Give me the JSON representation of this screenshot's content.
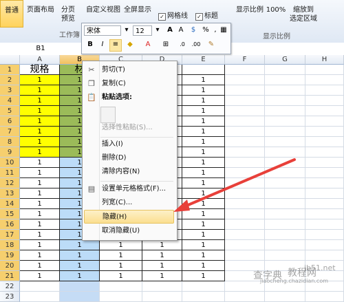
{
  "ribbon": {
    "normal_label": "普通",
    "page_layout_label": "页面布局",
    "page_break_label_1": "分页",
    "page_break_label_2": "预览",
    "custom_view_label": "自定义视图",
    "fullscreen_label": "全屏显示",
    "gridlines_label": "网格线",
    "headings_label": "标题",
    "show_ratio_label": "显示比例",
    "zoom100_label": "100%",
    "zoom_to_selection_1": "缩放到",
    "zoom_to_selection_2": "选定区域",
    "workbook_views_group": "工作簿",
    "zoom_group": "显示比例"
  },
  "mini_toolbar": {
    "font_name": "宋体",
    "font_size": "12",
    "bold": "B",
    "italic": "I",
    "percent": "%",
    "comma": ","
  },
  "formula_bar": {
    "name_box": "B1"
  },
  "columns": [
    "A",
    "B",
    "C",
    "D",
    "E",
    "F",
    "G",
    "H"
  ],
  "rows": [
    "1",
    "2",
    "3",
    "4",
    "5",
    "6",
    "7",
    "8",
    "9",
    "10",
    "11",
    "12",
    "13",
    "14",
    "15",
    "16",
    "17",
    "18",
    "19",
    "20",
    "21",
    "22",
    "23"
  ],
  "cells": {
    "A1": "规格",
    "B1": "材",
    "data_value": "1"
  },
  "context_menu": {
    "cut": "剪切(T)",
    "copy": "复制(C)",
    "paste_options": "粘贴选项:",
    "paste_special": "选择性粘贴(S)...",
    "insert": "插入(I)",
    "delete": "删除(D)",
    "clear_contents": "清除内容(N)",
    "format_cells": "设置单元格格式(F)...",
    "column_width": "列宽(C)...",
    "hide": "隐藏(H)",
    "unhide": "取消隐藏(U)"
  },
  "watermark": {
    "site1": "jb51.net",
    "site2": "jiaocheng.chazidian.com",
    "text1": "查字典",
    "text2": "教程网"
  },
  "colors": {
    "yellow_fill": "#ffff00",
    "green_fill": "#9bbb59",
    "blue_fill": "#bcdcf8",
    "arrow": "#e8403a"
  }
}
